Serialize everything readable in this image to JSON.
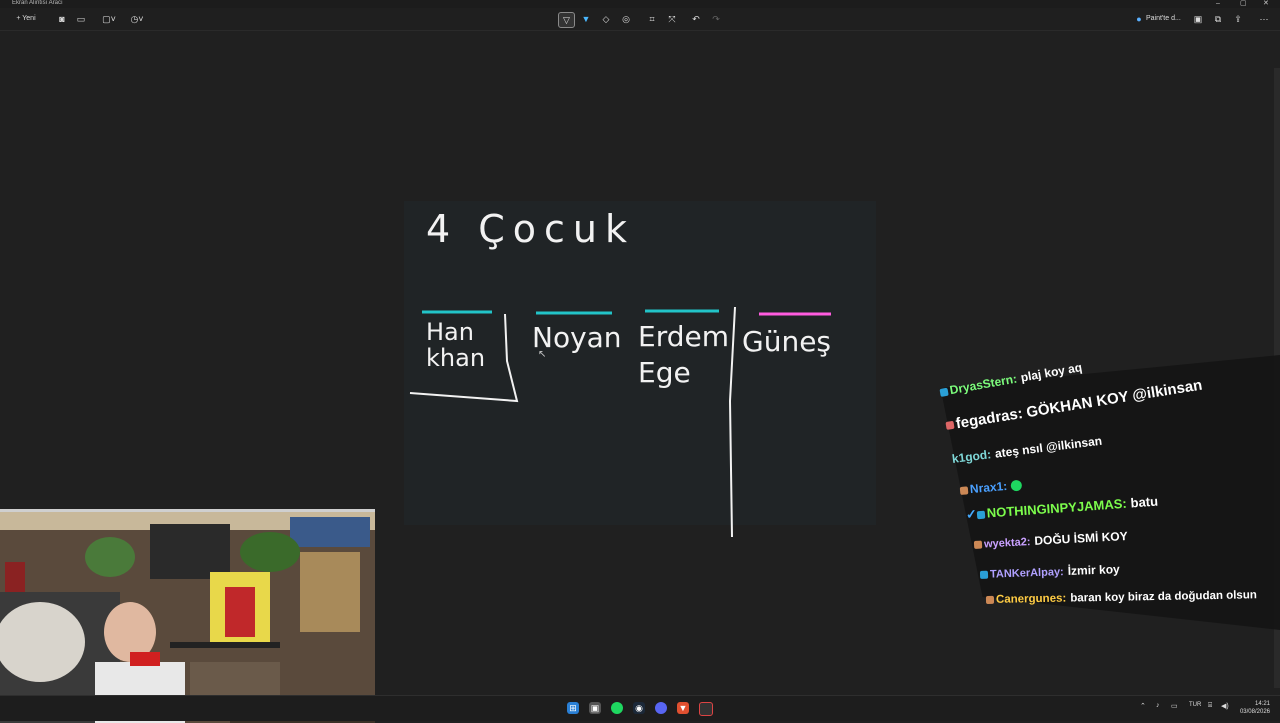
{
  "window": {
    "title": "Ekran Alıntısı Aracı"
  },
  "toolbar": {
    "new_label": "+ Yeni",
    "paint_label": "Paint'te d..."
  },
  "board": {
    "title": "4 Çocuk",
    "names": [
      "Han khan",
      "Noyan",
      "Erdem Ege",
      "Güneş"
    ]
  },
  "chat": {
    "messages": [
      {
        "user": "DryasStern:",
        "text": "plaj koy aq",
        "color": "#7cfc7c"
      },
      {
        "user": "fegadras:",
        "text": "GÖKHAN KOY @ilkinsan",
        "color": "#ffffff"
      },
      {
        "user": "k1god:",
        "text": "ateş nsıl @ilkinsan",
        "color": "#7fd8d8"
      },
      {
        "user": "Nrax1:",
        "text": "",
        "color": "#4aa0ff"
      },
      {
        "user": "NOTHINGINPYJAMAS:",
        "text": "batu",
        "color": "#7cfc4c"
      },
      {
        "user": "wyekta2:",
        "text": "DOĞU İSMİ KOY",
        "color": "#c9a0ff"
      },
      {
        "user": "TANKerAlpay:",
        "text": "İzmir koy",
        "color": "#b0a0ff"
      },
      {
        "user": "Canergunes:",
        "text": "baran koy biraz da doğudan olsun",
        "color": "#ffcc44"
      }
    ]
  },
  "taskbar": {
    "lang": "TUR",
    "time": "14:21",
    "date": "03/08/2026"
  },
  "colors": {
    "accent_teal": "#22c4c8",
    "accent_pink": "#ff5ce0"
  }
}
